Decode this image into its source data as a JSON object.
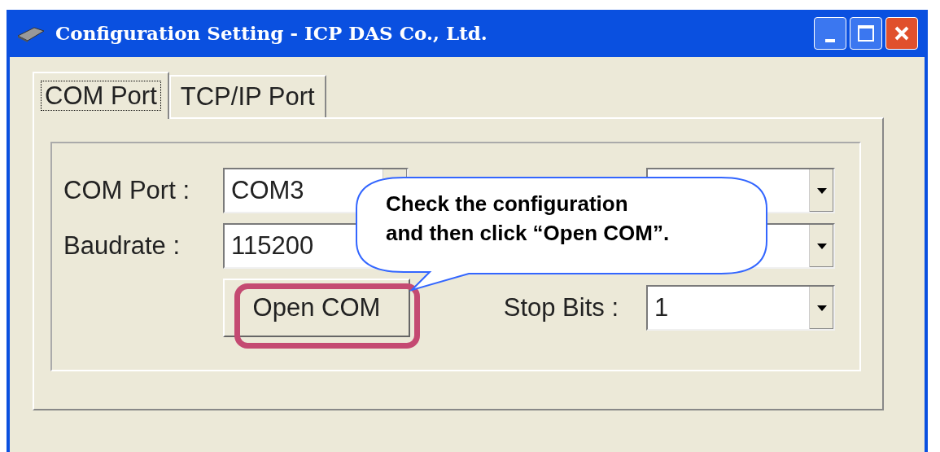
{
  "window": {
    "title": "Configuration Setting - ICP DAS Co., Ltd."
  },
  "tabs": [
    {
      "label": "COM Port",
      "selected": true
    },
    {
      "label": "TCP/IP Port",
      "selected": false
    }
  ],
  "left_fields": [
    {
      "label": "COM Port :",
      "value": "COM3"
    },
    {
      "label": "Baudrate :",
      "value": "115200"
    }
  ],
  "open_button": {
    "label": "Open COM",
    "highlighted": true
  },
  "right_fields": [
    {
      "kind": "combo"
    },
    {
      "kind": "combo"
    },
    {
      "kind": "combo",
      "label": "Stop Bits :",
      "value": "1"
    }
  ],
  "callout": {
    "lines": [
      "Check the configuration",
      "and then click “Open COM”."
    ]
  }
}
